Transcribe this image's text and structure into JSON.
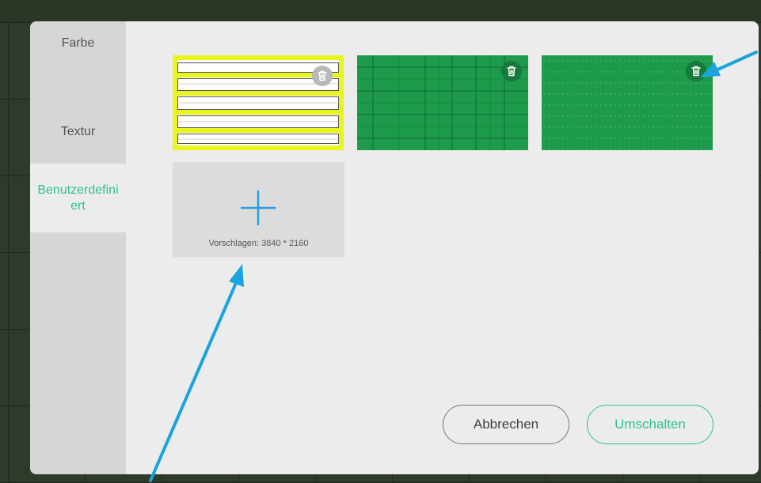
{
  "sidebar": {
    "items": [
      {
        "label": "Farbe",
        "active": false
      },
      {
        "label": "Textur",
        "active": false
      },
      {
        "label": "Benutzerdefiniert",
        "active": true
      }
    ]
  },
  "backgrounds": [
    {
      "name": "lined-paper",
      "selected": true,
      "delete_icon": "trash-icon"
    },
    {
      "name": "green-grid",
      "selected": false,
      "delete_icon": "trash-icon"
    },
    {
      "name": "green-dots",
      "selected": false,
      "delete_icon": "trash-icon"
    }
  ],
  "add_tile": {
    "icon": "plus-icon",
    "hint": "Vorschlagen: 3840 * 2160"
  },
  "buttons": {
    "cancel_label": "Abbrechen",
    "switch_label": "Umschalten"
  },
  "colors": {
    "accent": "#2ec28e",
    "selection": "#e8f51e",
    "board_green": "#1d9a4b",
    "annotation_arrow": "#1aa3dc"
  }
}
